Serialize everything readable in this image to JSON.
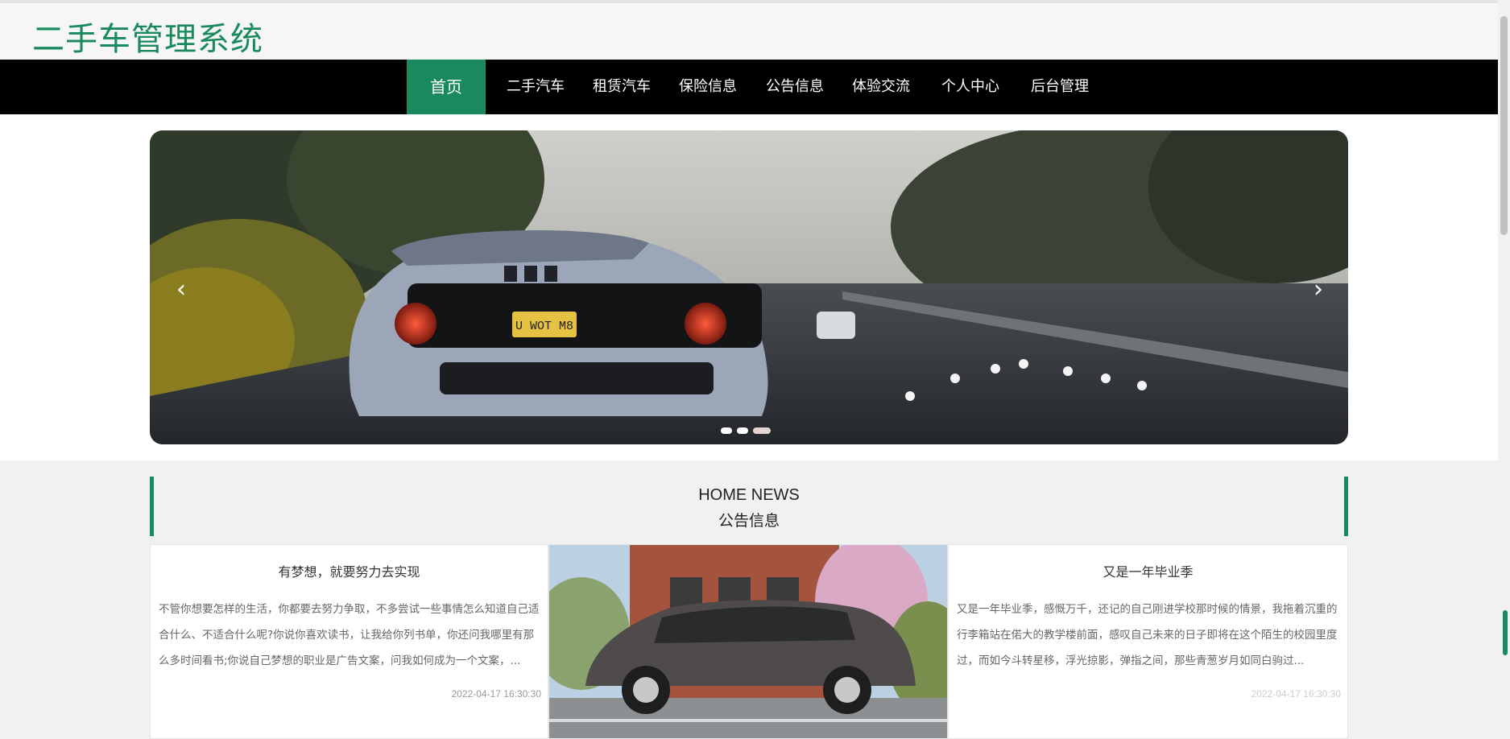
{
  "site": {
    "title": "二手车管理系统"
  },
  "nav": {
    "items": [
      {
        "label": "首页"
      },
      {
        "label": "二手汽车"
      },
      {
        "label": "租赁汽车"
      },
      {
        "label": "保险信息"
      },
      {
        "label": "公告信息"
      },
      {
        "label": "体验交流"
      },
      {
        "label": "个人中心"
      },
      {
        "label": "后台管理"
      }
    ],
    "active_index": 0
  },
  "carousel": {
    "prev_icon": "chevron-left-icon",
    "next_icon": "chevron-right-icon",
    "slide_count": 3,
    "active_slide": 2,
    "plate_text": "U WOT M8"
  },
  "news": {
    "title": "HOME NEWS",
    "subtitle": "公告信息",
    "cards": [
      {
        "title": "有梦想，就要努力去实现",
        "body": "不管你想要怎样的生活，你都要去努力争取，不多尝试一些事情怎么知道自己适合什么、不适合什么呢?你说你喜欢读书，让我给你列书单，你还问我哪里有那么多时间看书;你说自己梦想的职业是广告文案，问我如何成为一个文案，...",
        "date": "2022-04-17 16:30:30"
      },
      {
        "title": "又是一年毕业季",
        "body": "又是一年毕业季，感慨万千，还记的自己刚进学校那时候的情景，我拖着沉重的行李箱站在偌大的教学楼前面，感叹自己未来的日子即将在这个陌生的校园里度过，而如今斗转星移，浮光掠影，弹指之间，那些青葱岁月如同白驹过...",
        "date": "2022-04-17 16:30:30"
      }
    ]
  },
  "colors": {
    "accent": "#1a8a5e",
    "nav_bg": "#000000"
  }
}
